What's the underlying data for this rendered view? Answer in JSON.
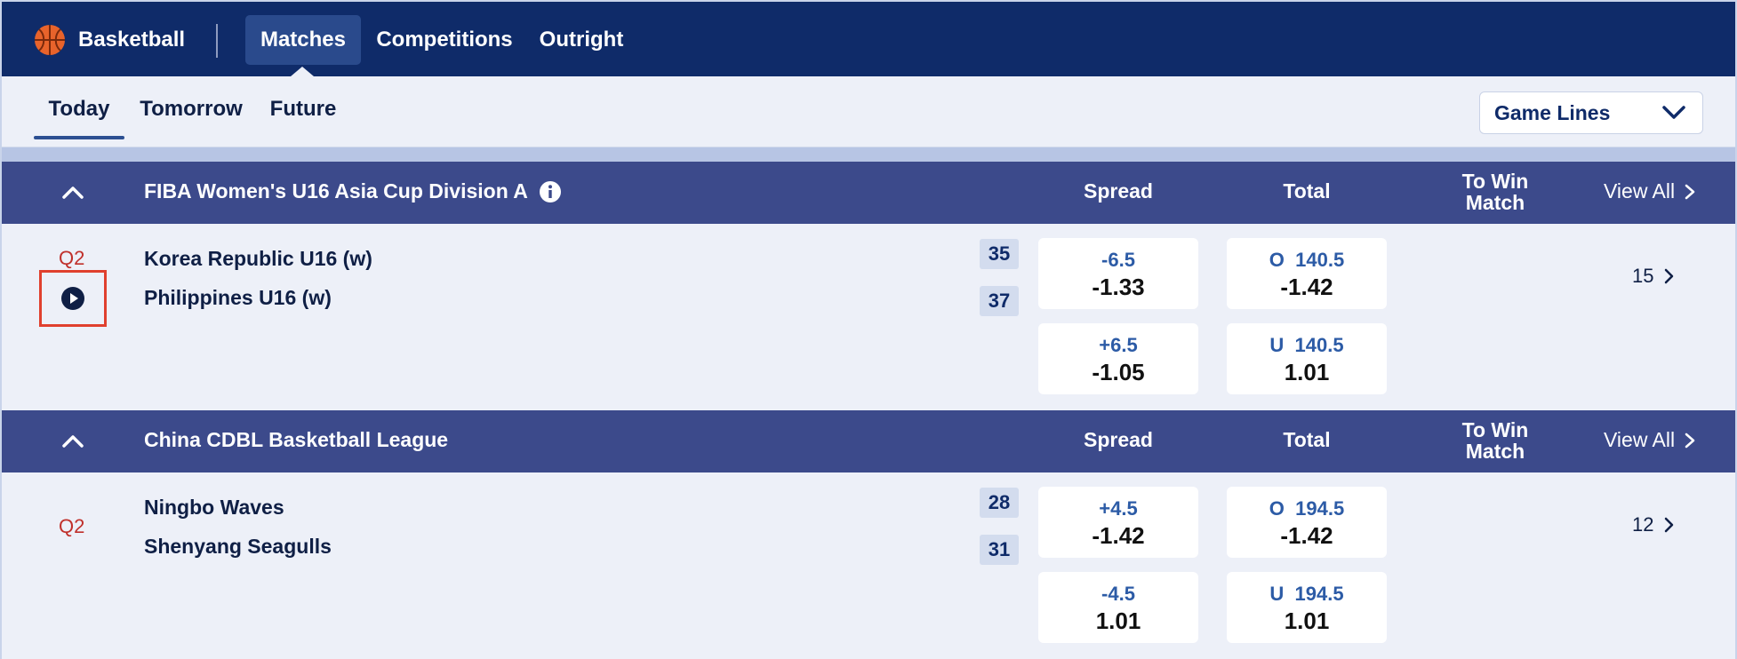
{
  "topnav": {
    "sport": "Basketball",
    "tabs": [
      "Matches",
      "Competitions",
      "Outright"
    ],
    "active_tab": "Matches"
  },
  "daytabs": {
    "items": [
      "Today",
      "Tomorrow",
      "Future"
    ],
    "active": "Today",
    "market_select": "Game Lines"
  },
  "columns": {
    "spread": "Spread",
    "total": "Total",
    "to_win_1": "To Win",
    "to_win_2": "Match",
    "view_all": "View All"
  },
  "leagues": [
    {
      "name": "FIBA Women's U16 Asia Cup Division A",
      "has_info": true,
      "match": {
        "period": "Q2",
        "home": "Korea Republic U16 (w)",
        "away": "Philippines U16 (w)",
        "home_score": "35",
        "away_score": "37",
        "spread": [
          {
            "line": "-6.5",
            "price": "-1.33"
          },
          {
            "line": "+6.5",
            "price": "-1.05"
          }
        ],
        "total": [
          {
            "line": "O  140.5",
            "price": "-1.42"
          },
          {
            "line": "U  140.5",
            "price": "1.01"
          }
        ],
        "more_markets": "15"
      }
    },
    {
      "name": "China CDBL Basketball League",
      "has_info": false,
      "match": {
        "period": "Q2",
        "home": "Ningbo Waves",
        "away": "Shenyang Seagulls",
        "home_score": "28",
        "away_score": "31",
        "spread": [
          {
            "line": "+4.5",
            "price": "-1.42"
          },
          {
            "line": "-4.5",
            "price": "1.01"
          }
        ],
        "total": [
          {
            "line": "O  194.5",
            "price": "-1.42"
          },
          {
            "line": "U  194.5",
            "price": "1.01"
          }
        ],
        "more_markets": "12"
      }
    }
  ],
  "colors": {
    "nav_bg": "#0f2b69",
    "league_bg": "#3c4a8b",
    "accent_blue": "#2c5ba6",
    "period_red": "#c0302b",
    "highlight_box": "#e0402e"
  }
}
